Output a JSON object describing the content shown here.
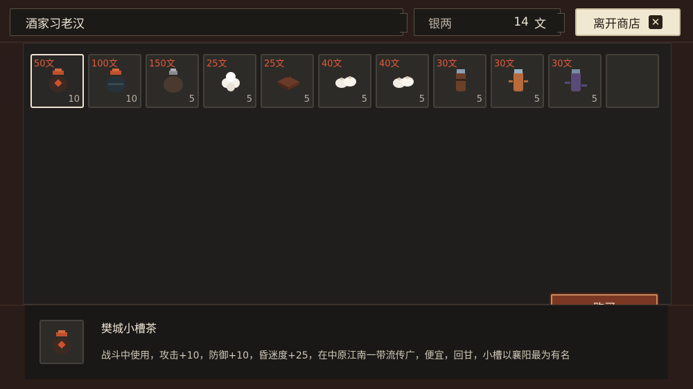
{
  "shop": {
    "title": "酒家习老汉",
    "money_label": "银两",
    "money_amount": "14",
    "money_unit": "文",
    "leave_label": "离开商店",
    "leave_icon": "close-icon"
  },
  "items": [
    {
      "price": "50文",
      "qty": "10",
      "icon": "wine-jar-red-icon",
      "selected": true
    },
    {
      "price": "100文",
      "qty": "10",
      "icon": "wine-jar-blue-icon"
    },
    {
      "price": "150文",
      "qty": "5",
      "icon": "wine-jar-brown-icon"
    },
    {
      "price": "25文",
      "qty": "5",
      "icon": "white-buns-icon"
    },
    {
      "price": "25文",
      "qty": "5",
      "icon": "brown-cake-icon"
    },
    {
      "price": "40文",
      "qty": "5",
      "icon": "steamed-buns-icon"
    },
    {
      "price": "40文",
      "qty": "5",
      "icon": "steamed-buns-icon"
    },
    {
      "price": "30文",
      "qty": "5",
      "icon": "bottle-brown-icon"
    },
    {
      "price": "30文",
      "qty": "5",
      "icon": "bottle-orange-icon"
    },
    {
      "price": "30文",
      "qty": "5",
      "icon": "bottle-purple-icon"
    },
    {
      "price": "",
      "qty": "",
      "icon": ""
    }
  ],
  "detail": {
    "name": "樊城小槽茶",
    "description": "战斗中使用，攻击+10，防御+10，昏迷度+25，在中原江南一带流传广，便宜，回甘，小槽以襄阳最为有名",
    "icon": "wine-jar-red-icon"
  },
  "buy_label": "购买",
  "colors": {
    "price": "#e05a3a",
    "accent": "#7a3824",
    "panel": "#201e1c"
  }
}
